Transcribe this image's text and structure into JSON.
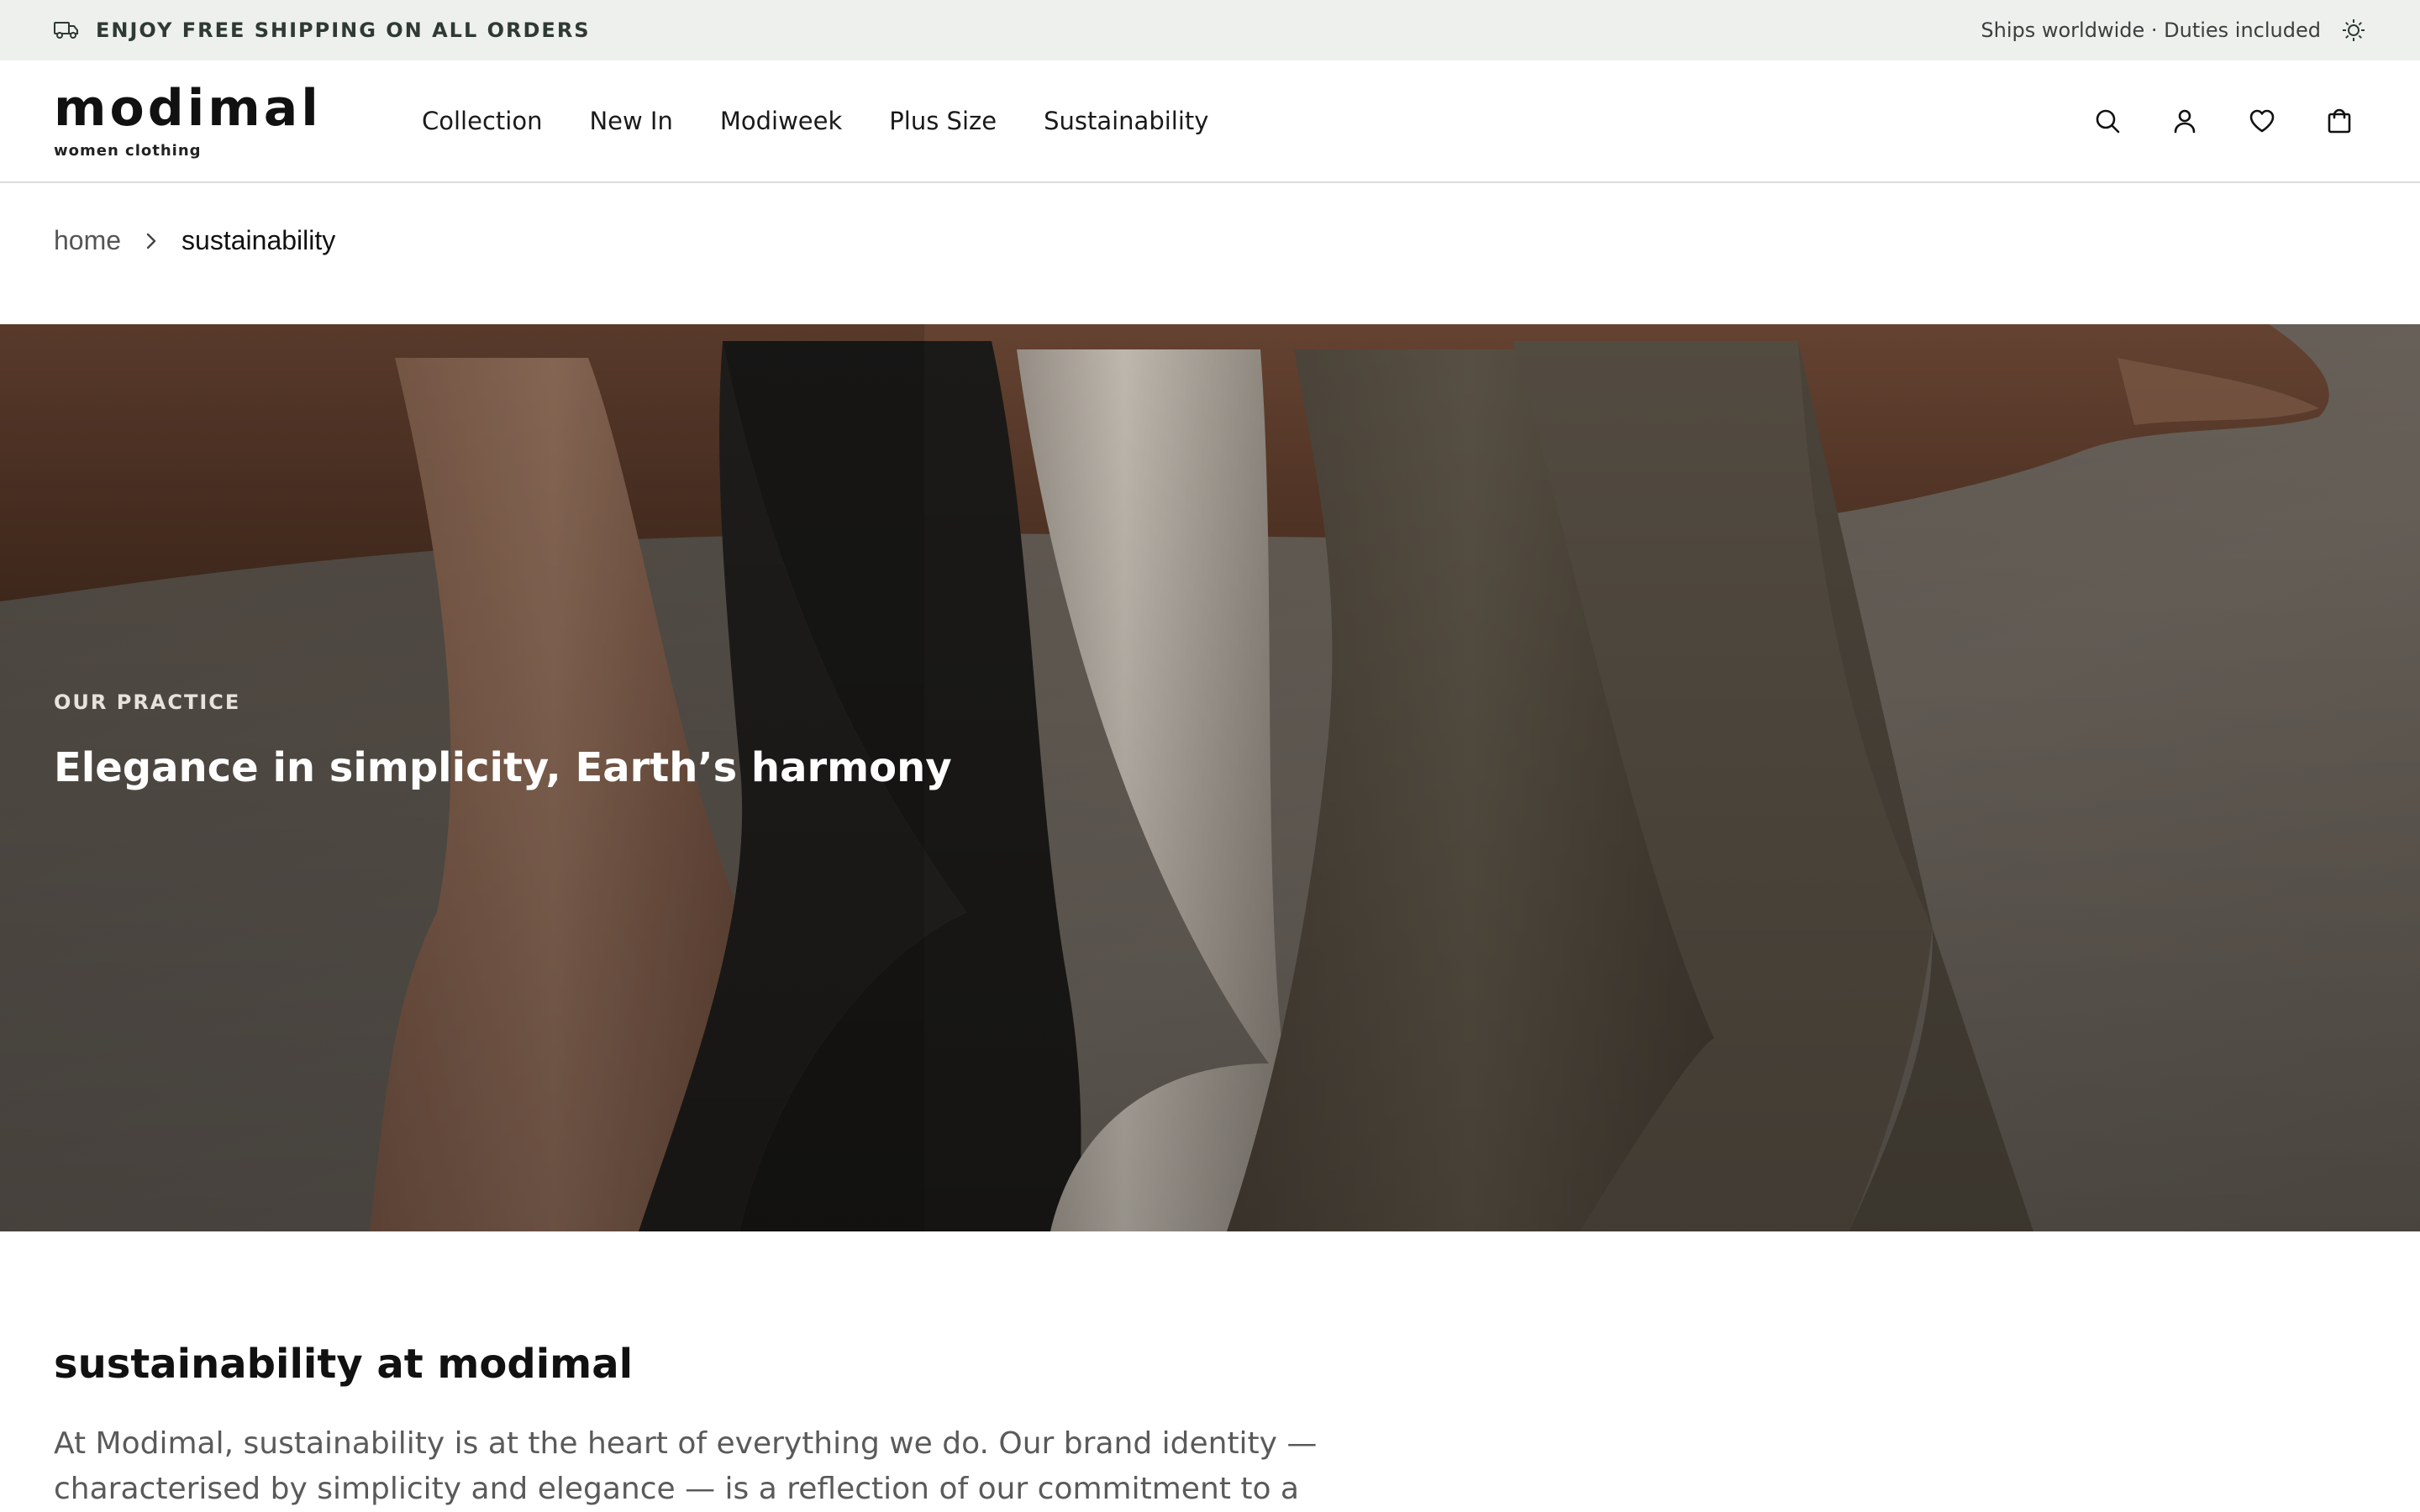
{
  "announcement": {
    "promo_text": "ENJOY FREE SHIPPING ON ALL ORDERS",
    "shipping_note": "Ships worldwide · Duties included",
    "promo_icon": "truck-icon",
    "theme_icon": "sun-icon"
  },
  "header": {
    "logo": {
      "wordmark": "modimal",
      "tagline": "women clothing"
    },
    "nav": [
      {
        "label": "Collection"
      },
      {
        "label": "New In"
      },
      {
        "label": "Modiweek"
      },
      {
        "label": "Plus Size"
      },
      {
        "label": "Sustainability"
      }
    ],
    "actions": [
      "search-icon",
      "user-icon",
      "heart-icon",
      "bag-icon"
    ]
  },
  "breadcrumb": {
    "home": "home",
    "current": "sustainability"
  },
  "hero": {
    "eyebrow": "OUR PRACTICE",
    "headline": "Elegance in simplicity, Earth’s harmony"
  },
  "content": {
    "title": "sustainability at modimal",
    "body": "At Modimal, sustainability is at the heart of everything we do. Our brand identity — characterised by simplicity and elegance — is a reflection of our commitment to a"
  },
  "colors": {
    "announcement_bg": "#eef0ee",
    "text_dark": "#111111",
    "body_text": "#5a5a5a",
    "hero_overlay_text": "#ffffff"
  }
}
